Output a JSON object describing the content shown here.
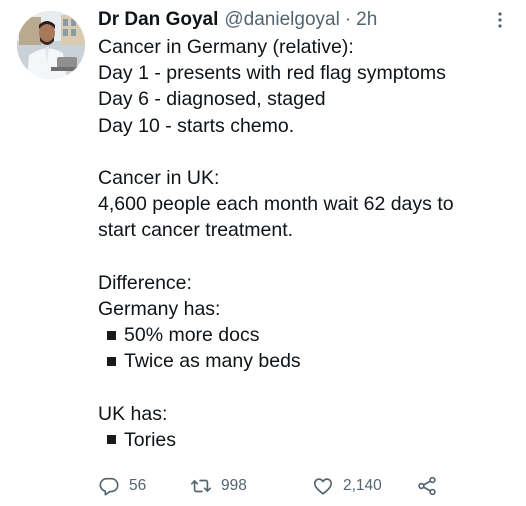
{
  "tweet": {
    "author_name": "Dr Dan Goyal",
    "handle": "@danielgoyal",
    "separator": "·",
    "time": "2h",
    "lines": [
      "Cancer in Germany (relative):",
      "Day 1 - presents with red flag symptoms",
      "Day 6 - diagnosed, staged",
      "Day 10 - starts chemo.",
      "",
      "Cancer in UK:",
      "4,600 people each month wait 62 days to",
      "start cancer treatment.",
      "",
      "Difference:",
      "Germany has:",
      "50% more docs",
      "Twice as many beds",
      "",
      "UK has:",
      "Tories"
    ]
  },
  "actions": {
    "reply_count": "56",
    "retweet_count": "998",
    "like_count": "2,140"
  },
  "icons": {
    "reply": "reply-icon",
    "retweet": "retweet-icon",
    "like": "heart-icon",
    "share": "share-icon",
    "more": "more-vertical-icon"
  },
  "colors": {
    "text": "#0f1419",
    "secondary": "#536471"
  }
}
